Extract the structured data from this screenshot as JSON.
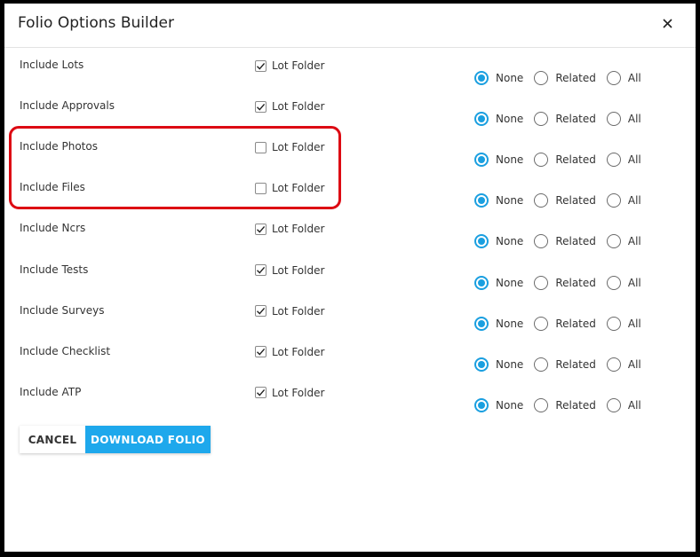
{
  "dialog": {
    "title": "Folio Options Builder",
    "close_icon": "close-icon (×)"
  },
  "options": [
    {
      "label": "Include Lots",
      "lot_folder_label": "Lot Folder",
      "lot_folder_checked": true,
      "selected": "None"
    },
    {
      "label": "Include Approvals",
      "lot_folder_label": "Lot Folder",
      "lot_folder_checked": true,
      "selected": "None"
    },
    {
      "label": "Include Photos",
      "lot_folder_label": "Lot Folder",
      "lot_folder_checked": false,
      "selected": "None"
    },
    {
      "label": "Include Files",
      "lot_folder_label": "Lot Folder",
      "lot_folder_checked": false,
      "selected": "None"
    },
    {
      "label": "Include Ncrs",
      "lot_folder_label": "Lot Folder",
      "lot_folder_checked": true,
      "selected": "None"
    },
    {
      "label": "Include Tests",
      "lot_folder_label": "Lot Folder",
      "lot_folder_checked": true,
      "selected": "None"
    },
    {
      "label": "Include Surveys",
      "lot_folder_label": "Lot Folder",
      "lot_folder_checked": true,
      "selected": "None"
    },
    {
      "label": "Include Checklist",
      "lot_folder_label": "Lot Folder",
      "lot_folder_checked": true,
      "selected": "None"
    },
    {
      "label": "Include ATP",
      "lot_folder_label": "Lot Folder",
      "lot_folder_checked": true,
      "selected": "None"
    }
  ],
  "radio_options": [
    "None",
    "Related",
    "All"
  ],
  "buttons": {
    "cancel": "CANCEL",
    "download": "DOWNLOAD FOLIO"
  },
  "colors": {
    "accent": "#1a9fe0",
    "primary_button": "#1ea8ec",
    "highlight_annotation": "#dd0a13"
  }
}
